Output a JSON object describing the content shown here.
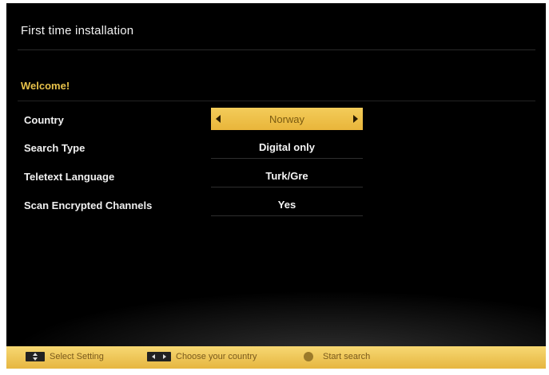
{
  "header": {
    "title": "First time installation"
  },
  "welcome": "Welcome!",
  "settings": [
    {
      "label": "Country",
      "value": "Norway"
    },
    {
      "label": "Search Type",
      "value": "Digital only"
    },
    {
      "label": "Teletext Language",
      "value": "Turk/Gre"
    },
    {
      "label": "Scan Encrypted Channels",
      "value": "Yes"
    }
  ],
  "footer": {
    "select_setting": "Select Setting",
    "choose_country": "Choose your country",
    "start_search": "Start search"
  },
  "colors": {
    "accent": "#efc24d",
    "background": "#000000"
  }
}
